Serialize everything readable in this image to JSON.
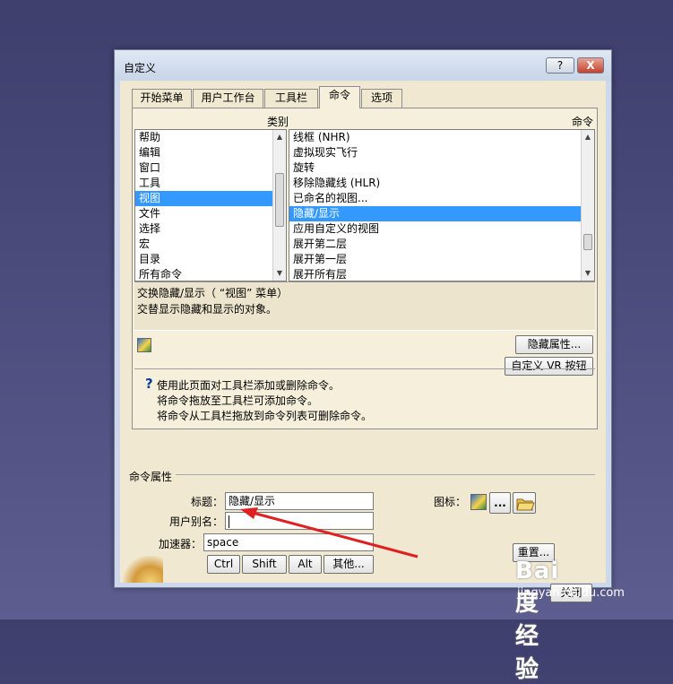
{
  "window": {
    "title": "自定义",
    "help_label": "?",
    "close_label": "X"
  },
  "tabs": [
    {
      "label": "开始菜单",
      "active": false
    },
    {
      "label": "用户工作台",
      "active": false
    },
    {
      "label": "工具栏",
      "active": false
    },
    {
      "label": "命令",
      "active": true
    },
    {
      "label": "选项",
      "active": false
    }
  ],
  "categories": {
    "header": "类别",
    "items": [
      "帮助",
      "编辑",
      "窗口",
      "工具",
      "视图",
      "文件",
      "选择",
      "宏",
      "目录",
      "所有命令"
    ],
    "selected": "视图"
  },
  "commands": {
    "header": "命令",
    "items": [
      "线框 (NHR)",
      "虚拟现实飞行",
      "旋转",
      "移除隐藏线 (HLR)",
      "已命名的视图...",
      "隐藏/显示",
      "应用自定义的视图",
      "展开第二层",
      "展开第一层",
      "展开所有层"
    ],
    "selected": "隐藏/显示"
  },
  "description": {
    "line1": "交换隐藏/显示（ “视图” 菜单）",
    "line2": "交替显示隐藏和显示的对象。"
  },
  "buttons": {
    "hide_props": "隐藏属性...",
    "custom_vr": "自定义 VR 按钮",
    "reset": "重置...",
    "close": "关闭"
  },
  "hint": {
    "line1": "使用此页面对工具栏添加或删除命令。",
    "line2": "将命令拖放至工具栏可添加命令。",
    "line3": "将命令从工具栏拖放到命令列表可删除命令。"
  },
  "props": {
    "group_label": "命令属性",
    "title_label": "标题：",
    "title_value": "隐藏/显示",
    "alias_label": "用户别名：",
    "alias_value": "",
    "accel_label": "加速器：",
    "accel_value": "space",
    "icon_label": "图标：",
    "browse_label": "...",
    "modifiers": [
      "Ctrl",
      "Shift",
      "Alt",
      "其他..."
    ]
  },
  "annotation": {
    "color": "#e02020"
  },
  "watermark": {
    "logo": "Bai度 经验",
    "url": "jingyan.baidu.com"
  }
}
